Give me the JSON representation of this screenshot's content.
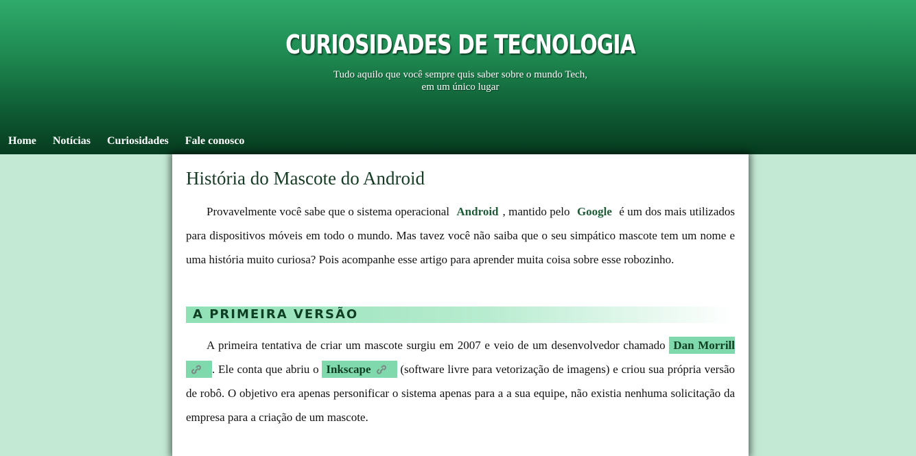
{
  "header": {
    "title": "CURIOSIDADES DE TECNOLOGIA",
    "subtitle_line1": "Tudo aquilo que você sempre quis saber sobre o mundo Tech,",
    "subtitle_line2": "em um único lugar"
  },
  "nav": {
    "items": [
      {
        "label": "Home"
      },
      {
        "label": "Notícias"
      },
      {
        "label": "Curiosidades"
      },
      {
        "label": "Fale conosco"
      }
    ]
  },
  "article": {
    "title": "História do Mascote do Android",
    "intro": {
      "t1": "Provavelmente você sabe que o sistema operacional ",
      "kw1": "Android",
      "t2": ", mantido pelo ",
      "kw2": "Google",
      "t3": " é um dos mais utilizados para dispositivos móveis em todo o mundo. Mas tavez você não saiba que o seu simpático mascote tem um nome e uma história muito curiosa? Pois acompanhe esse artigo para aprender muita coisa sobre esse robozinho."
    },
    "section1": {
      "heading": "A PRIMEIRA VERSÃO",
      "t1": "A primeira tentativa de criar um mascote surgiu em 2007 e veio de um desenvolvedor chamado ",
      "link1": "Dan Morrill",
      "t2": ". Ele conta que abriu o ",
      "link2": "Inkscape",
      "t3": " (software livre para vetorização de imagens) e criou sua própria versão de robô. O objetivo era apenas personificar o sistema apenas para a a sua equipe, não existia nenhuma solicitação da empresa para a criação de um mascote."
    }
  },
  "icons": {
    "link_icon": "link-icon"
  },
  "colors": {
    "header_top": "#2fab6b",
    "header_bottom": "#063b1f",
    "page_background": "#c3e9d4",
    "link_highlight": "#7fd9ad",
    "keyword": "#1d5a36"
  }
}
